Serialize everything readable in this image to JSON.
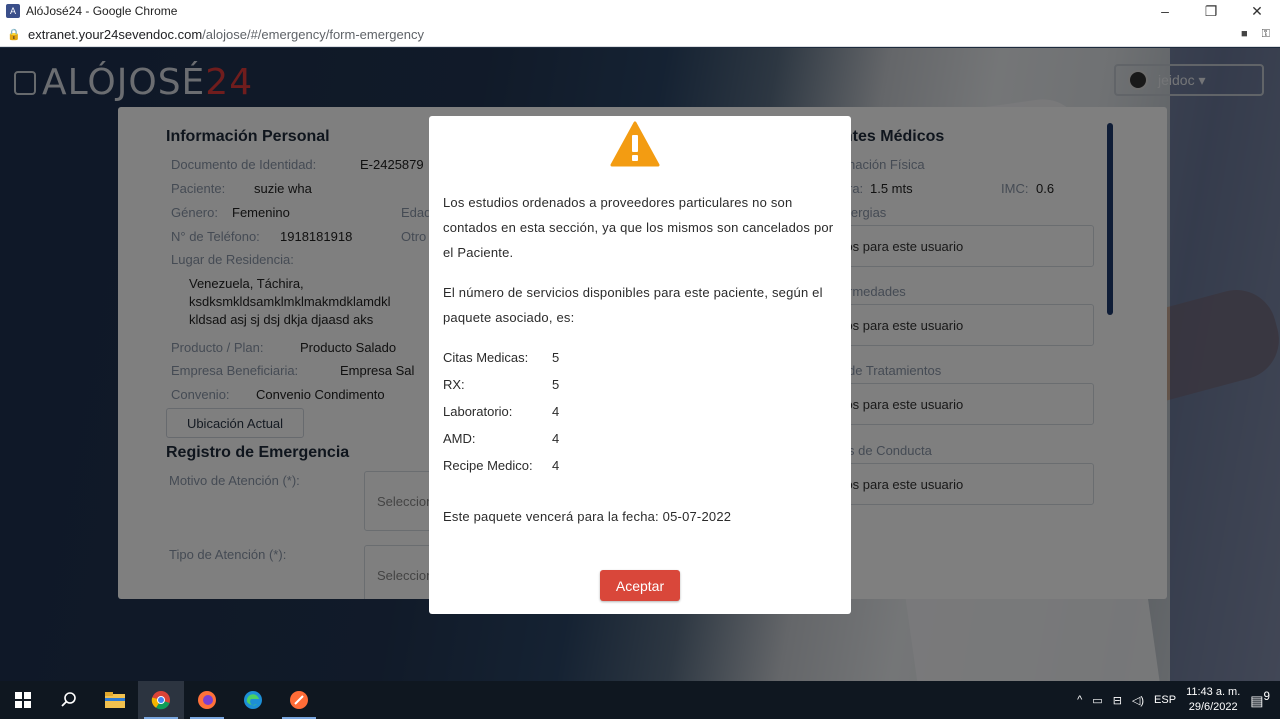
{
  "browser": {
    "window_title": "AlóJosé24 - Google Chrome",
    "url_host": "extranet.your24sevendoc.com",
    "url_path": "/alojose/#/emergency/form-emergency",
    "minimize": "–",
    "maximize": "❐",
    "close": "✕"
  },
  "header": {
    "logo_text": "ALÓJOSÉ",
    "logo_num": "24",
    "user_label": "jeidoc ▾"
  },
  "personal": {
    "title": "Información Personal",
    "doc_label": "Documento de Identidad:",
    "doc_value": "E-2425879",
    "patient_label": "Paciente:",
    "patient_value": "suzie wha",
    "gender_label": "Género:",
    "gender_value": "Femenino",
    "age_label": "Edad",
    "phone_label": "N° de Teléfono:",
    "phone_value": "1918181918",
    "other_label": "Otro",
    "residence_label": "Lugar de Residencia:",
    "residence_line1": "Venezuela, Táchira,",
    "residence_line2": "ksdksmkldsamklmklmakmdklamdkl",
    "residence_line3": "kldsad asj sj dsj dkja djaasd aks",
    "product_label": "Producto / Plan:",
    "product_value": "Producto Salado",
    "company_label": "Empresa Beneficiaria:",
    "company_value": "Empresa Sal",
    "agreement_label": "Convenio:",
    "agreement_value": "Convenio Condimento",
    "location_button": "Ubicación Actual"
  },
  "emergency": {
    "title": "Registro de Emergencia",
    "reason_label": "Motivo de Atención (*):",
    "reason_placeholder": "Seleccion",
    "type_label": "Tipo de Atención (*):",
    "type_placeholder": "Seleccion"
  },
  "medical": {
    "title": "entes Médicos",
    "physical_label": "nación Física",
    "height_label": "ra:",
    "height_value": "1.5 mts",
    "imc_label": "IMC:",
    "imc_value": "0.6",
    "allergies_label": "lergias",
    "diseases_label": "rmedades",
    "treatments_label": "de Tratamientos",
    "conduct_label": "s de Conducta",
    "no_records": "stros para este usuario"
  },
  "modal": {
    "text1": "Los estudios ordenados a proveedores particulares no son contados en esta sección, ya que los mismos son cancelados por el Paciente.",
    "text2": "El número de servicios disponibles para este paciente, según el paquete asociado, es:",
    "services": [
      {
        "name": "Citas Medicas:",
        "count": "5"
      },
      {
        "name": "RX:",
        "count": "5"
      },
      {
        "name": "Laboratorio:",
        "count": "4"
      },
      {
        "name": "AMD:",
        "count": "4"
      },
      {
        "name": "Recipe Medico:",
        "count": "4"
      }
    ],
    "expiry": "Este paquete vencerá para la fecha: 05-07-2022",
    "accept_button": "Aceptar",
    "warning_color": "#f39c12",
    "accept_color": "#d9473a"
  },
  "taskbar": {
    "lang": "ESP",
    "time": "11:43 a. m.",
    "date": "29/6/2022",
    "notifications": "9"
  }
}
